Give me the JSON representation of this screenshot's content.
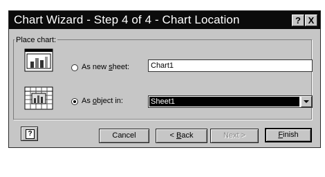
{
  "window": {
    "title": "Chart Wizard - Step 4 of 4 - Chart Location",
    "help_glyph": "?",
    "close_glyph": "X"
  },
  "group": {
    "label": "Place chart:"
  },
  "options": {
    "new_sheet": {
      "label_pre": "As new ",
      "label_key": "s",
      "label_post": "heet:",
      "selected": false,
      "value": "Chart1"
    },
    "as_object": {
      "label_pre": "As ",
      "label_key": "o",
      "label_post": "bject in:",
      "selected": true,
      "value": "Sheet1"
    }
  },
  "buttons": {
    "help_glyph": "?",
    "cancel": "Cancel",
    "back_pre": "< ",
    "back_key": "B",
    "back_post": "ack",
    "next": "Next >",
    "finish_key": "F",
    "finish_post": "inish"
  },
  "icons": {
    "new_sheet": "chart-sheet-icon",
    "as_object": "embedded-chart-icon",
    "help": "help-icon",
    "dropdown": "chevron-down-icon"
  }
}
